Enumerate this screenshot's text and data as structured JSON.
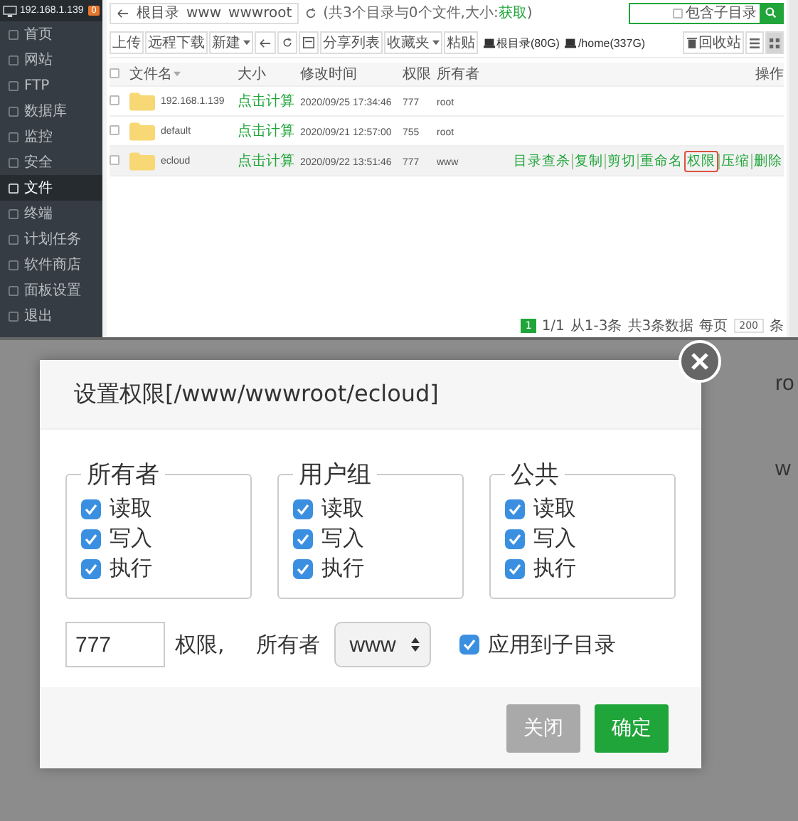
{
  "panel": {
    "sidebar": {
      "host": "192.168.1.139",
      "badge": "0",
      "items": [
        {
          "label": "首页",
          "selected": false
        },
        {
          "label": "网站",
          "selected": false
        },
        {
          "label": "FTP",
          "selected": false
        },
        {
          "label": "数据库",
          "selected": false
        },
        {
          "label": "监控",
          "selected": false
        },
        {
          "label": "安全",
          "selected": false
        },
        {
          "label": "文件",
          "selected": true
        },
        {
          "label": "终端",
          "selected": false
        },
        {
          "label": "计划任务",
          "selected": false
        },
        {
          "label": "软件商店",
          "selected": false
        },
        {
          "label": "面板设置",
          "selected": false
        },
        {
          "label": "退出",
          "selected": false
        }
      ]
    },
    "breadcrumb": [
      "根目录",
      "www",
      "wwwroot"
    ],
    "summary": {
      "text": "(共3个目录与0个文件,大小:",
      "link": "获取",
      "end": ")"
    },
    "search": {
      "subdir_label": "包含子目录",
      "subdir_checked": false
    },
    "toolbar": [
      {
        "kind": "text",
        "label": "上传"
      },
      {
        "kind": "text",
        "label": "远程下载"
      },
      {
        "kind": "dropdown",
        "label": "新建"
      },
      {
        "kind": "back"
      },
      {
        "kind": "refresh"
      },
      {
        "kind": "terminal"
      },
      {
        "kind": "text",
        "label": "分享列表"
      },
      {
        "kind": "dropdown",
        "label": "收藏夹"
      },
      {
        "kind": "text",
        "label": "粘贴"
      }
    ],
    "disks": [
      "根目录(80G)",
      "/home(337G)"
    ],
    "recycle": "回收站",
    "views": [
      {
        "selected": false
      },
      {
        "selected": true
      }
    ],
    "columns": [
      "文件名",
      "大小",
      "修改时间",
      "权限",
      "所有者",
      "操作"
    ],
    "all_checked": false,
    "rows": [
      {
        "name": "192.168.1.139",
        "size": "点击计算",
        "modified": "2020/09/25 17:34:46",
        "permission": "777",
        "owner": "root",
        "checked": false,
        "hovered": false,
        "actions": []
      },
      {
        "name": "default",
        "size": "点击计算",
        "modified": "2020/09/21 12:57:00",
        "permission": "755",
        "owner": "root",
        "checked": false,
        "hovered": false,
        "actions": []
      },
      {
        "name": "ecloud",
        "size": "点击计算",
        "modified": "2020/09/22 13:51:46",
        "permission": "777",
        "owner": "www",
        "checked": false,
        "hovered": true,
        "actions": [
          {
            "label": "目录查杀",
            "highlighted": false
          },
          {
            "label": "复制",
            "highlighted": false
          },
          {
            "label": "剪切",
            "highlighted": false
          },
          {
            "label": "重命名",
            "highlighted": false
          },
          {
            "label": "权限",
            "highlighted": true
          },
          {
            "label": "压缩",
            "highlighted": false
          },
          {
            "label": "删除",
            "highlighted": false
          }
        ]
      }
    ],
    "pagination": {
      "current": "1",
      "pages": "1/1",
      "range": "从1-3条",
      "total": "共3条数据",
      "per_page_label": "每页",
      "per_page": "200",
      "unit": "条"
    }
  },
  "background_texts": [
    "ro",
    "w"
  ],
  "dialog": {
    "title": "设置权限[/www/wwwroot/ecloud]",
    "groups": [
      {
        "title": "所有者",
        "permissions": [
          {
            "label": "读取",
            "checked": true
          },
          {
            "label": "写入",
            "checked": true
          },
          {
            "label": "执行",
            "checked": true
          }
        ]
      },
      {
        "title": "用户组",
        "permissions": [
          {
            "label": "读取",
            "checked": true
          },
          {
            "label": "写入",
            "checked": true
          },
          {
            "label": "执行",
            "checked": true
          }
        ]
      },
      {
        "title": "公共",
        "permissions": [
          {
            "label": "读取",
            "checked": true
          },
          {
            "label": "写入",
            "checked": true
          },
          {
            "label": "执行",
            "checked": true
          }
        ]
      }
    ],
    "mode": "777",
    "mode_label": "权限,",
    "owner_label": "所有者",
    "owner": "www",
    "recursive": {
      "label": "应用到子目录",
      "checked": true
    },
    "buttons": [
      {
        "kind": "cancel",
        "label": "关闭"
      },
      {
        "kind": "primary",
        "label": "确定"
      }
    ]
  }
}
